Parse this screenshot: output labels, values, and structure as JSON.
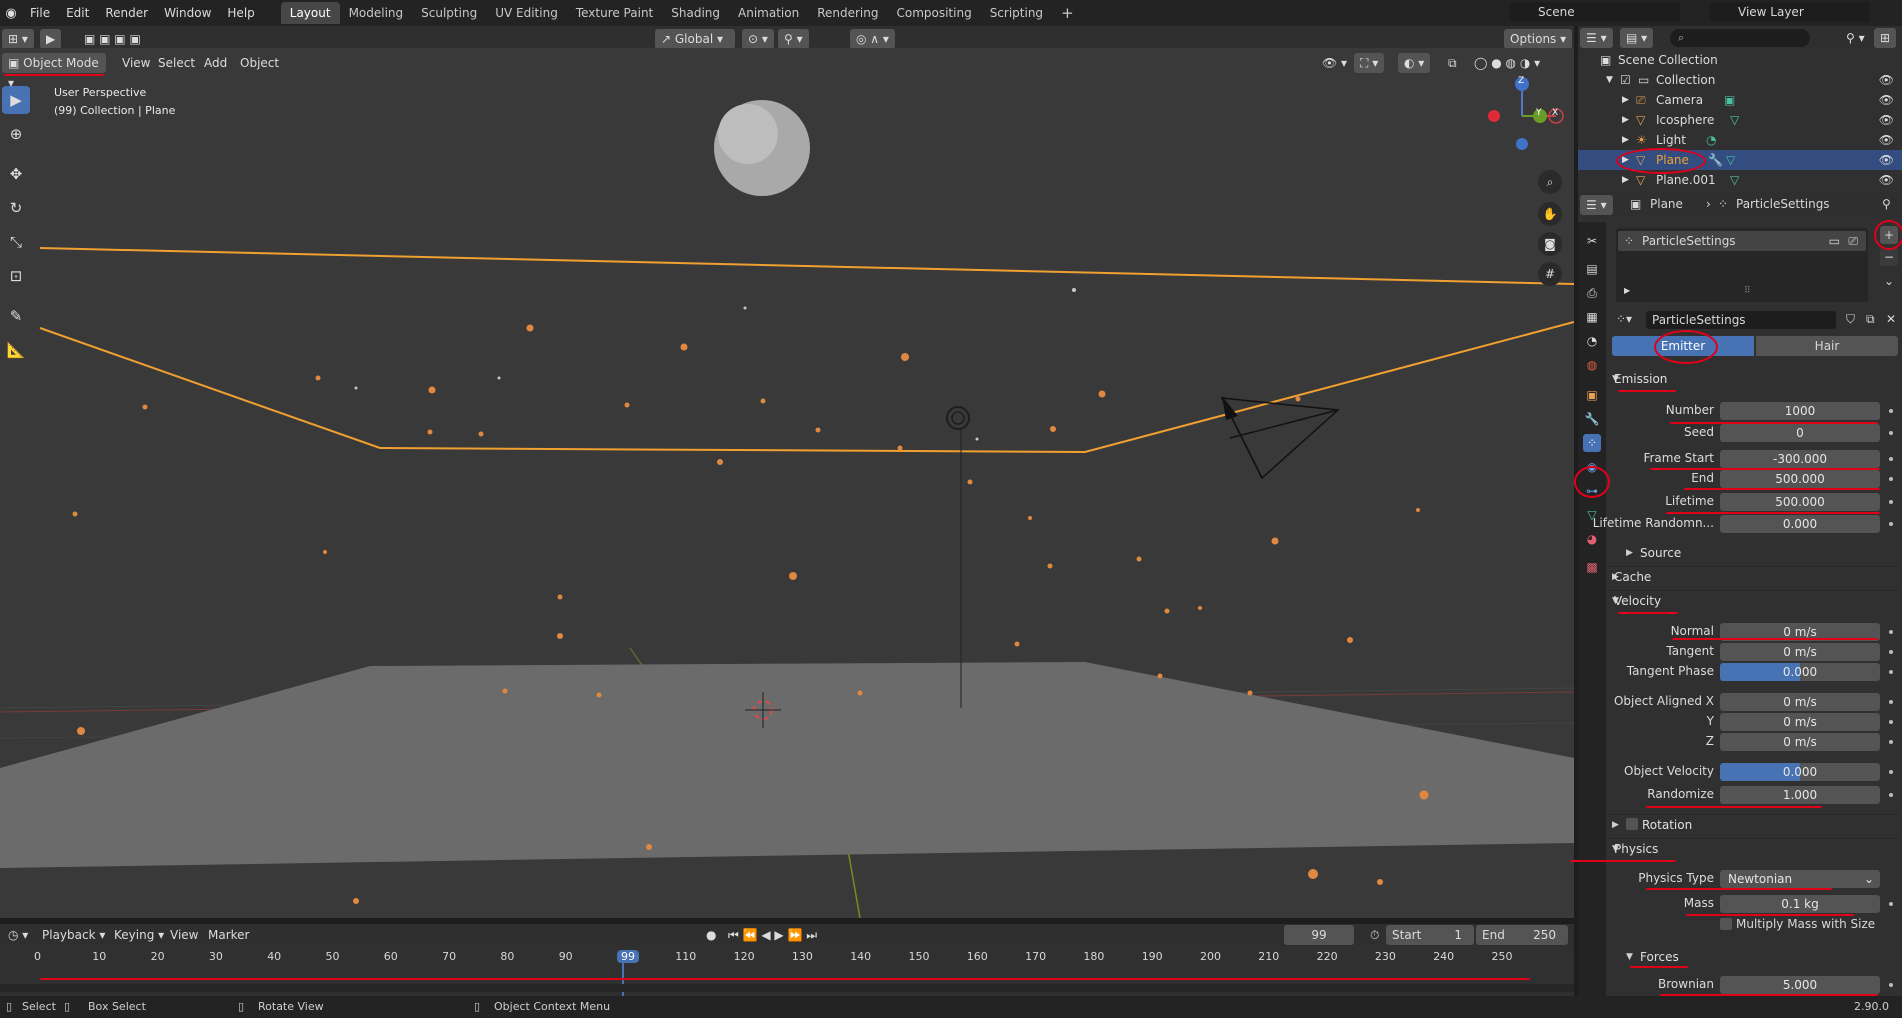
{
  "menu": [
    "File",
    "Edit",
    "Render",
    "Window",
    "Help"
  ],
  "workspaces": [
    "Layout",
    "Modeling",
    "Sculpting",
    "UV Editing",
    "Texture Paint",
    "Shading",
    "Animation",
    "Rendering",
    "Compositing",
    "Scripting"
  ],
  "active_workspace": "Layout",
  "scene": "Scene",
  "view_layer": "View Layer",
  "transform_orientation": "Global",
  "options_label": "Options",
  "mode": "Object Mode",
  "viewport_menu": [
    "View",
    "Select",
    "Add",
    "Object"
  ],
  "viewport_overlay": {
    "perspective": "User Perspective",
    "collection": "(99) Collection | Plane"
  },
  "gizmo_axes": {
    "z": "Z",
    "x": "X",
    "y": "Y"
  },
  "outliner": {
    "root": "Scene Collection",
    "collection": "Collection",
    "items": [
      "Camera",
      "Icosphere",
      "Light",
      "Plane",
      "Plane.001"
    ],
    "selected": "Plane"
  },
  "properties": {
    "breadcrumb_object": "Plane",
    "breadcrumb_settings": "ParticleSettings",
    "slot_name": "ParticleSettings",
    "datablock_name": "ParticleSettings",
    "type_emitter": "Emitter",
    "type_hair": "Hair",
    "emission": {
      "title": "Emission",
      "number_label": "Number",
      "number": "1000",
      "seed_label": "Seed",
      "seed": "0",
      "frame_start_label": "Frame Start",
      "frame_start": "-300.000",
      "end_label": "End",
      "end": "500.000",
      "lifetime_label": "Lifetime",
      "lifetime": "500.000",
      "lifetime_random_label": "Lifetime Randomn...",
      "lifetime_random": "0.000",
      "source_label": "Source"
    },
    "cache_label": "Cache",
    "velocity": {
      "title": "Velocity",
      "normal_label": "Normal",
      "normal": "0 m/s",
      "tangent_label": "Tangent",
      "tangent": "0 m/s",
      "tangent_phase_label": "Tangent Phase",
      "tangent_phase": "0.000",
      "obj_aligned_x_label": "Object Aligned X",
      "obj_aligned_x": "0 m/s",
      "y_label": "Y",
      "y": "0 m/s",
      "z_label": "Z",
      "z": "0 m/s",
      "object_velocity_label": "Object Velocity",
      "object_velocity": "0.000",
      "randomize_label": "Randomize",
      "randomize": "1.000"
    },
    "rotation_label": "Rotation",
    "physics": {
      "title": "Physics",
      "type_label": "Physics Type",
      "type": "Newtonian",
      "mass_label": "Mass",
      "mass": "0.1 kg",
      "multiply_mass_label": "Multiply Mass with Size",
      "forces_label": "Forces",
      "brownian_label": "Brownian",
      "brownian": "5.000"
    }
  },
  "timeline": {
    "menu": [
      "Playback",
      "Keying",
      "View",
      "Marker"
    ],
    "current_frame": "99",
    "start_label": "Start",
    "start": "1",
    "end_label": "End",
    "end": "250",
    "ticks": [
      "0",
      "10",
      "20",
      "30",
      "40",
      "50",
      "60",
      "70",
      "80",
      "90",
      "99",
      "110",
      "120",
      "130",
      "140",
      "150",
      "160",
      "170",
      "180",
      "190",
      "200",
      "210",
      "220",
      "230",
      "240",
      "250"
    ]
  },
  "statusbar": {
    "select": "Select",
    "box_select": "Box Select",
    "rotate_view": "Rotate View",
    "context_menu": "Object Context Menu",
    "version": "2.90.0"
  },
  "colors": {
    "accent": "#4772b3",
    "selection_orange": "#f0a030",
    "annotation_red": "#e0001a",
    "particle": "#e08840"
  }
}
